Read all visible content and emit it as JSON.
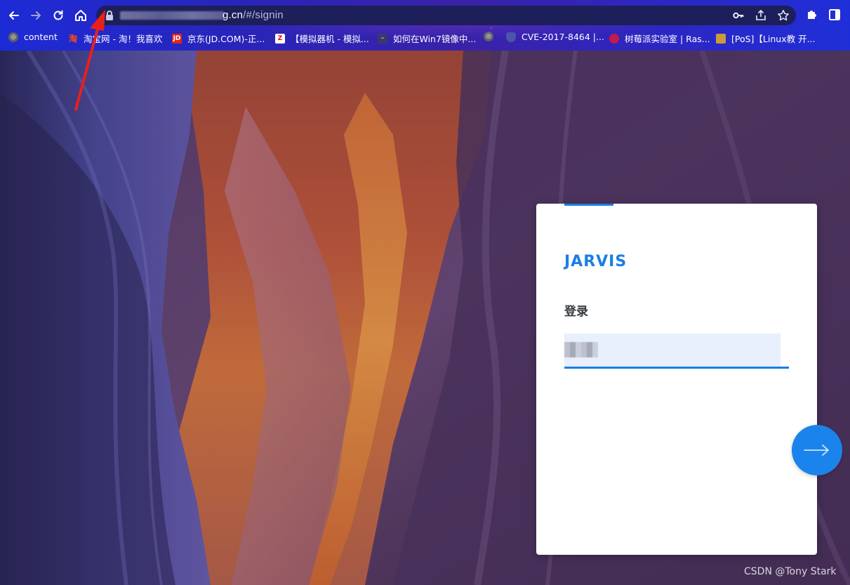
{
  "browser": {
    "url_host_suffix": "g.cn",
    "url_path": "/#/signin",
    "bookmarks": [
      {
        "label": "content",
        "icon": "globe-icon",
        "color": "#5f6368"
      },
      {
        "label": "淘宝网 - 淘！我喜欢",
        "icon": "taobao-icon",
        "color": "#ff5000"
      },
      {
        "label": "京东(JD.COM)-正...",
        "icon": "jd-icon",
        "color": "#e1251b"
      },
      {
        "label": "【模拟器机 - 模拟...",
        "icon": "z-icon",
        "color": "#e60012"
      },
      {
        "label": "如何在Win7镜像中...",
        "icon": "site-icon",
        "color": "#3a3a6a"
      },
      {
        "label": "",
        "icon": "globe-icon",
        "color": "#5f6368"
      },
      {
        "label": "CVE-2017-8464 |...",
        "icon": "shield-icon",
        "color": "#4a56a8"
      },
      {
        "label": "树莓派实验室 | Ras...",
        "icon": "raspberry-icon",
        "color": "#c51a4a"
      },
      {
        "label": "[PoS]【Linux教 开...",
        "icon": "box-icon",
        "color": "#c89b3c"
      }
    ]
  },
  "login": {
    "brand": "JARVIS",
    "title": "登录",
    "input_value": ""
  },
  "colors": {
    "accent": "#1a7ee6",
    "input_bg": "#e8f0fe"
  },
  "watermark": "CSDN @Tony Stark"
}
